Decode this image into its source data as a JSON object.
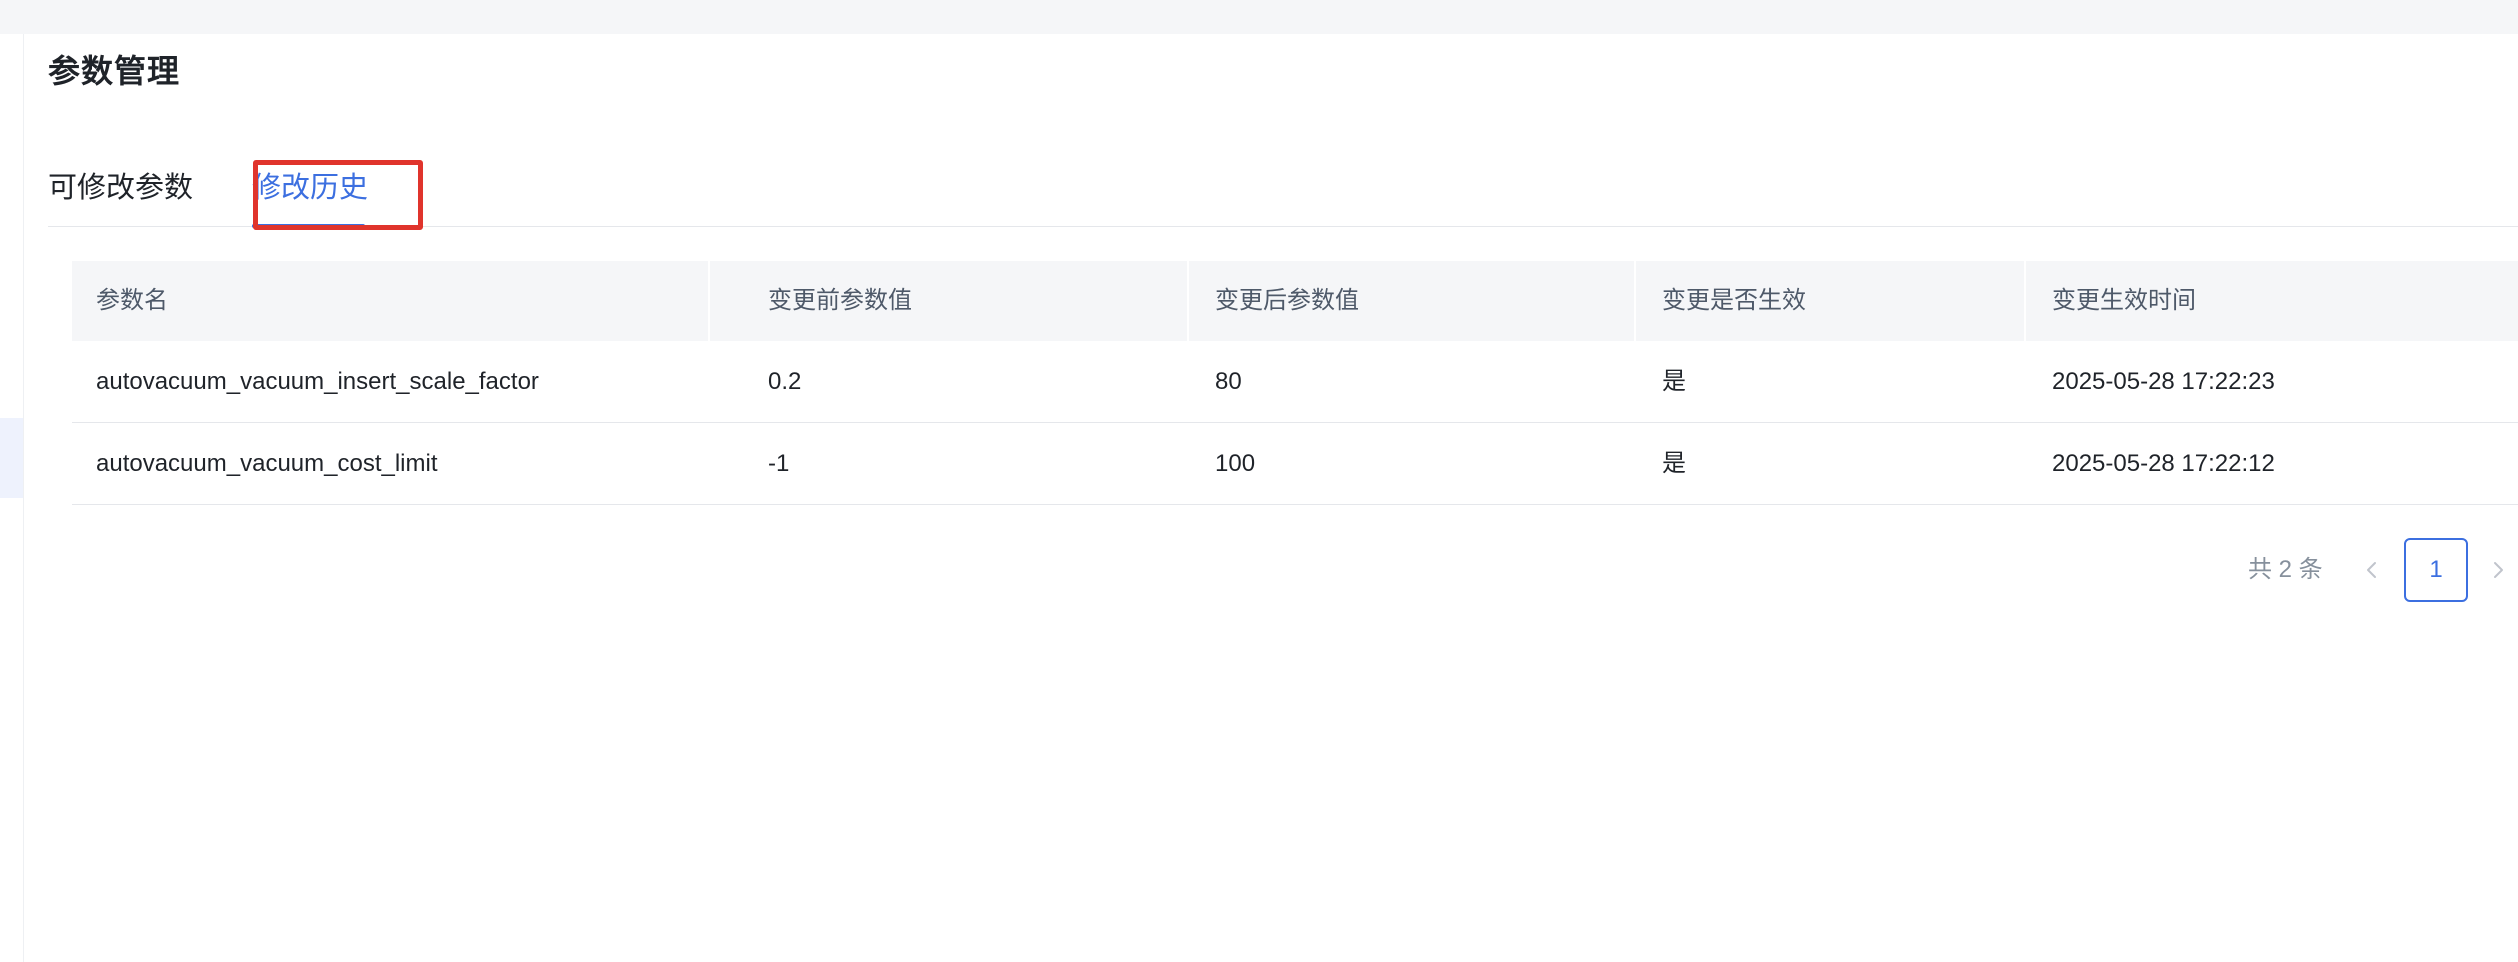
{
  "page": {
    "title": "参数管理"
  },
  "tabs": [
    {
      "label": "可修改参数",
      "active": false
    },
    {
      "label": "修改历史",
      "active": true
    }
  ],
  "table": {
    "columns": [
      "参数名",
      "变更前参数值",
      "变更后参数值",
      "变更是否生效",
      "变更生效时间"
    ],
    "rows": [
      [
        "autovacuum_vacuum_insert_scale_factor",
        "0.2",
        "80",
        "是",
        "2025-05-28 17:22:23"
      ],
      [
        "autovacuum_vacuum_cost_limit",
        "-1",
        "100",
        "是",
        "2025-05-28 17:22:12"
      ]
    ]
  },
  "pagination": {
    "total_text": "共 2 条",
    "current_page": "1",
    "prev_icon": "chevron-left-icon",
    "next_icon": "chevron-right-icon"
  },
  "colors": {
    "accent": "#3c6fe0",
    "highlight": "#e0342c",
    "header_bg": "#f5f6f8"
  }
}
